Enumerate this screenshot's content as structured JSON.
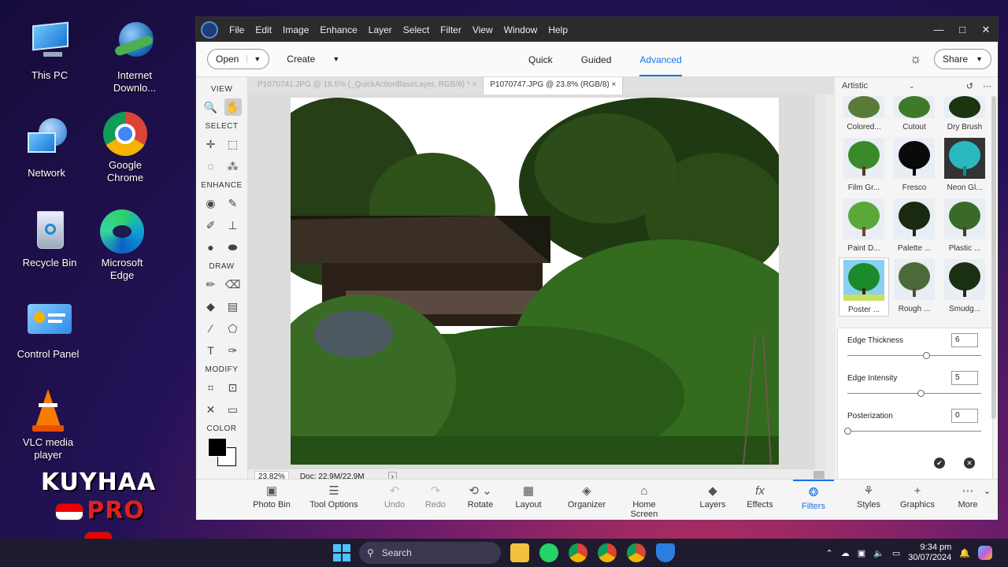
{
  "desktop": {
    "icons": [
      {
        "label": "This PC"
      },
      {
        "label": "Internet\nDownlo..."
      },
      {
        "label": "Network"
      },
      {
        "label": "Google\nChrome"
      },
      {
        "label": "Recycle Bin"
      },
      {
        "label": "Microsoft\nEdge"
      },
      {
        "label": "Control Panel"
      },
      {
        "label": "VLC media\nplayer"
      }
    ],
    "brand_line1": "KUYHAA",
    "brand_line2": "PRO"
  },
  "window": {
    "menu": [
      "File",
      "Edit",
      "Image",
      "Enhance",
      "Layer",
      "Select",
      "Filter",
      "View",
      "Window",
      "Help"
    ],
    "controls": [
      "—",
      "□",
      "✕"
    ]
  },
  "topbar": {
    "open": "Open",
    "create": "Create",
    "modes": [
      "Quick",
      "Guided",
      "Advanced"
    ],
    "active_mode": "Advanced",
    "share": "Share"
  },
  "toolbox": {
    "sections": [
      "VIEW",
      "SELECT",
      "ENHANCE",
      "DRAW",
      "MODIFY",
      "COLOR"
    ]
  },
  "tabs": [
    {
      "label": "P1070741.JPG @ 18.5% (_QuickActionBaseLayer, RGB/8) *",
      "close": "×"
    },
    {
      "label": "P1070747.JPG @ 23.8% (RGB/8)",
      "close": "×"
    }
  ],
  "status": {
    "zoom": "23.82%",
    "doc": "Doc: 22.9M/22.9M",
    "arrow": "›"
  },
  "filters": {
    "category": "Artistic",
    "items": [
      "Colored...",
      "Cutout",
      "Dry Brush",
      "Film Gr...",
      "Fresco",
      "Neon Gl...",
      "Paint D...",
      "Palette ...",
      "Plastic ...",
      "Poster ...",
      "Rough ...",
      "Smudg..."
    ],
    "selected": "Poster ..."
  },
  "settings": [
    {
      "label": "Edge Thickness",
      "value": "6",
      "level": 0.58
    },
    {
      "label": "Edge Intensity",
      "value": "5",
      "level": 0.54
    },
    {
      "label": "Posterization",
      "value": "0",
      "level": 0.0
    }
  ],
  "bottombar": [
    {
      "label": "Photo Bin",
      "icon": "photo-bin-icon"
    },
    {
      "label": "Tool Options",
      "icon": "tool-options-icon"
    },
    {
      "label": "Undo",
      "icon": "undo-icon"
    },
    {
      "label": "Redo",
      "icon": "redo-icon"
    },
    {
      "label": "Rotate",
      "icon": "rotate-icon"
    },
    {
      "label": "Layout",
      "icon": "layout-icon"
    },
    {
      "label": "Organizer",
      "icon": "organizer-icon"
    },
    {
      "label": "Home Screen",
      "icon": "home-icon"
    },
    {
      "label": "Layers",
      "icon": "layers-icon"
    },
    {
      "label": "Effects",
      "icon": "effects-icon"
    },
    {
      "label": "Filters",
      "icon": "filters-icon"
    },
    {
      "label": "Styles",
      "icon": "styles-icon"
    },
    {
      "label": "Graphics",
      "icon": "graphics-icon"
    },
    {
      "label": "More",
      "icon": "more-icon"
    }
  ],
  "taskbar": {
    "search": "Search",
    "time": "9:34 pm",
    "date": "30/07/2024"
  },
  "colors": {
    "accent": "#1a73e8"
  }
}
